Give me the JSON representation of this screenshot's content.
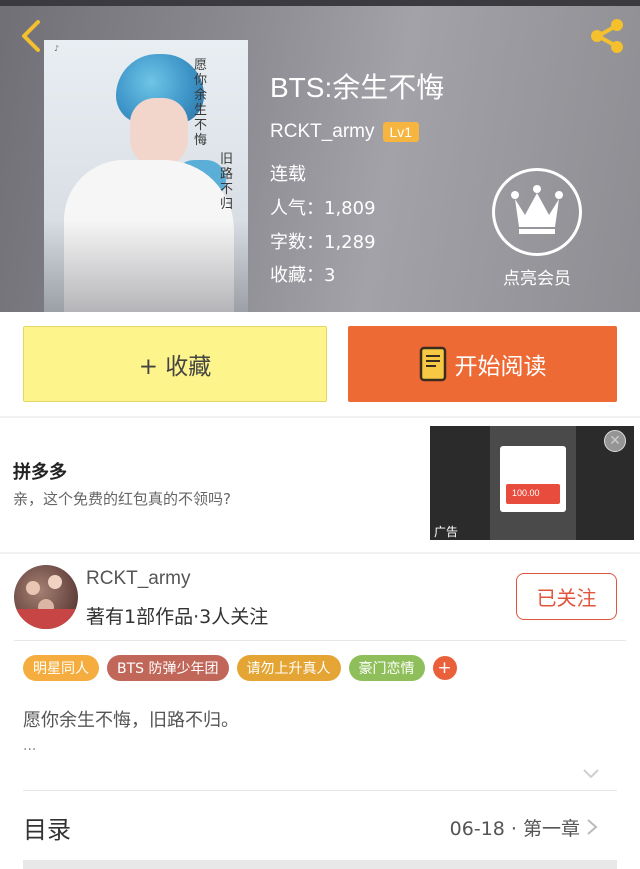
{
  "header": {
    "title": "BTS:余生不悔",
    "author": "RCKT_army",
    "level": "Lv1",
    "status": "连载",
    "popularity": "人气：1,809",
    "word_count": "字数：1,289",
    "favorites": "收藏：3",
    "vip_label": "点亮会员",
    "cover_calligraphy": "愿你余生不悔",
    "cover_calligraphy2": "旧路不归"
  },
  "actions": {
    "collect": "+ 收藏",
    "read": "开始阅读"
  },
  "ad": {
    "title": "拼多多",
    "description": "亲，这个免费的红包真的不领吗?",
    "image_amount": "100.00",
    "label": "广告"
  },
  "author_section": {
    "name": "RCKT_army",
    "stats": "著有1部作品·3人关注",
    "follow_label": "已关注",
    "tags": [
      {
        "label": "明星同人",
        "color": "#f5ad3f"
      },
      {
        "label": "BTS 防弹少年团",
        "color": "#c0675a"
      },
      {
        "label": "请勿上升真人",
        "color": "#e4a534"
      },
      {
        "label": "豪门恋情",
        "color": "#8fbf5a"
      }
    ],
    "tag_more": "+",
    "summary": "愿你余生不悔，旧路不归。",
    "summary_more": "...",
    "toc_title": "目录",
    "toc_latest": "06-18 · 第一章"
  },
  "colors": {
    "accent_orange": "#ee6a35",
    "collect_yellow": "#fdf48b",
    "follow_red": "#e2553d",
    "level_badge": "#f5b540"
  }
}
